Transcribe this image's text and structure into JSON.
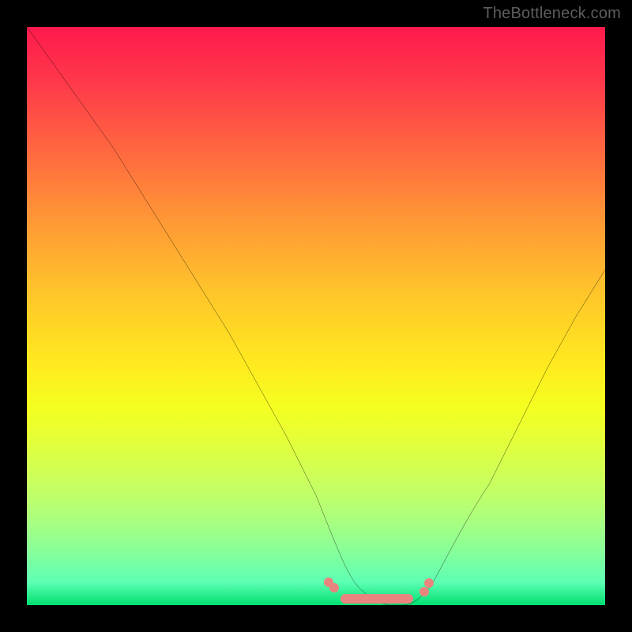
{
  "watermark": "TheBottleneck.com",
  "colors": {
    "page_bg": "#000000",
    "watermark_text": "#5d5d5d",
    "curve_stroke": "#000000",
    "marker_fill": "#e9857e",
    "gradient_top": "#ff1a4d",
    "gradient_mid": "#ffe91f",
    "gradient_bottom": "#00e070"
  },
  "chart_data": {
    "type": "line",
    "title": "",
    "xlabel": "",
    "ylabel": "",
    "xlim": [
      0,
      100
    ],
    "ylim": [
      0,
      100
    ],
    "grid": false,
    "legend": false,
    "background": "vertical-gradient red→yellow→green",
    "series": [
      {
        "name": "bottleneck-curve",
        "x": [
          0,
          5,
          10,
          15,
          20,
          25,
          30,
          35,
          40,
          45,
          50,
          52,
          55,
          58,
          61,
          63,
          65,
          67,
          70,
          75,
          80,
          85,
          90,
          95,
          100
        ],
        "y": [
          100,
          93,
          86,
          79,
          71,
          63,
          55,
          47,
          38,
          29,
          19,
          14,
          8,
          3,
          1,
          0,
          0,
          1,
          4,
          12,
          21,
          31,
          41,
          50,
          58
        ]
      }
    ],
    "markers": {
      "name": "valley-floor-highlight",
      "color": "#e9857e",
      "segments": [
        {
          "x_start": 54,
          "x_end": 68,
          "y": 0
        }
      ],
      "endpoints": [
        {
          "x": 52,
          "y": 2.5
        },
        {
          "x": 70,
          "y": 3
        }
      ]
    }
  }
}
